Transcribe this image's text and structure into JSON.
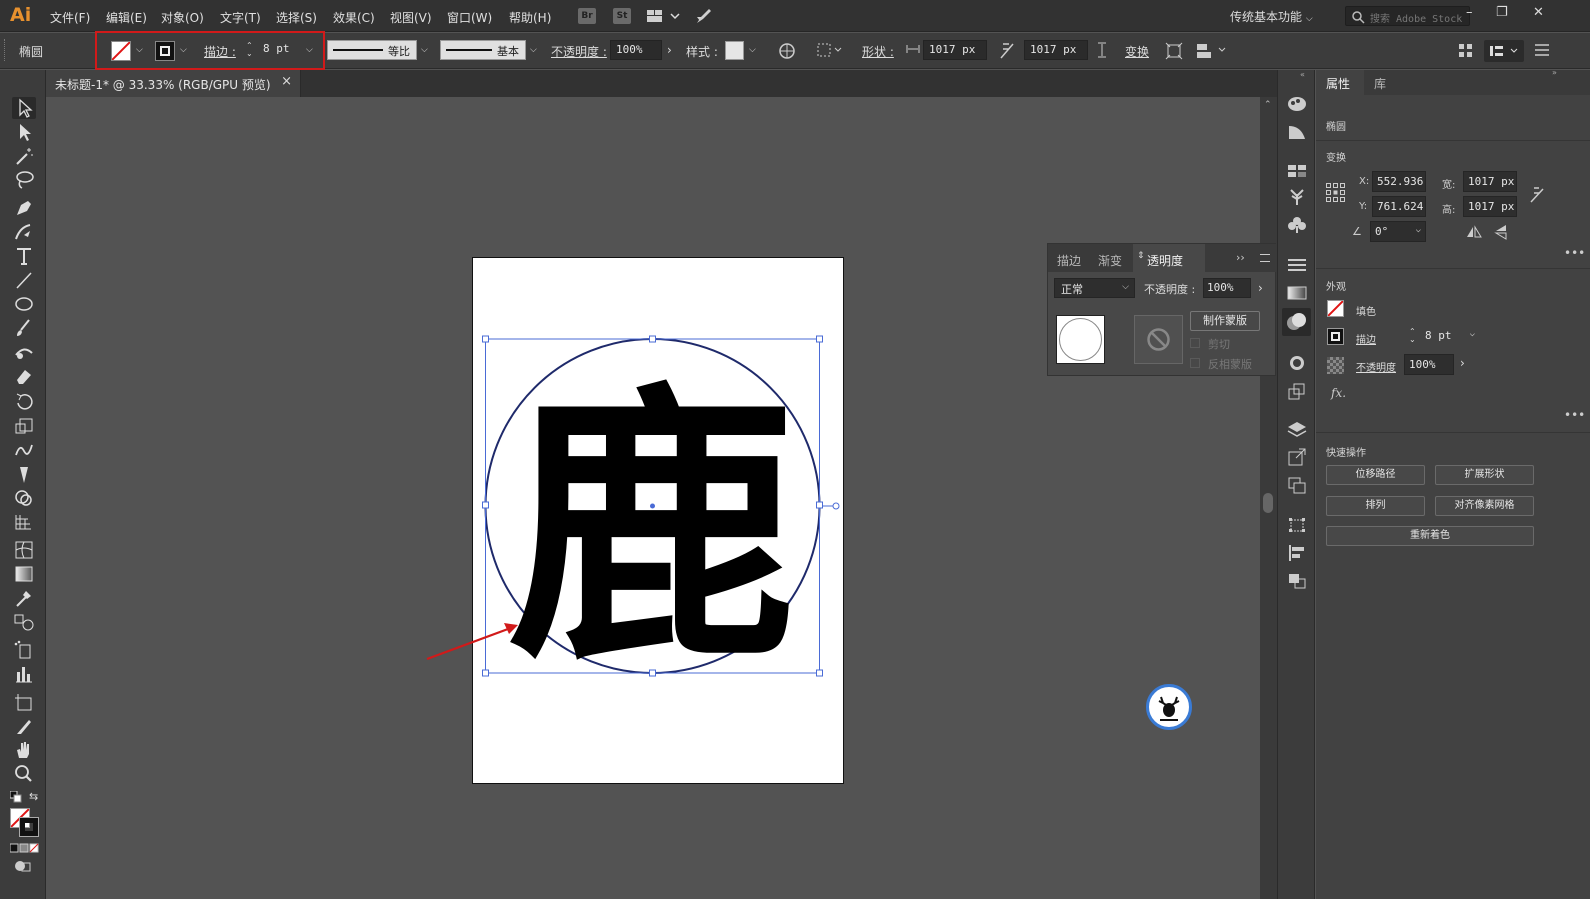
{
  "app": {
    "logo": "Ai"
  },
  "menu": [
    "文件(F)",
    "编辑(E)",
    "对象(O)",
    "文字(T)",
    "选择(S)",
    "效果(C)",
    "视图(V)",
    "窗口(W)",
    "帮助(H)"
  ],
  "menu_icons": {
    "bridge": "Br",
    "stock": "St"
  },
  "workspace": "传统基本功能",
  "search": {
    "placeholder": "搜索 Adobe Stock"
  },
  "window_controls": {
    "minimize": "–",
    "restore": "❐",
    "close": "✕"
  },
  "control_bar": {
    "object_type": "椭圆",
    "stroke_label": "描边 :",
    "stroke_value": "8 pt",
    "profile_label": "等比",
    "brush_label": "基本",
    "opacity_label": "不透明度 :",
    "opacity_value": "100%",
    "style_label": "样式 :",
    "shape_label": "形状 :",
    "width_value": "1017 px",
    "height_value": "1017 px",
    "transform_label": "变换"
  },
  "document_tab": {
    "title": "未标题-1* @ 33.33% (RGB/GPU 预览)",
    "close": "×"
  },
  "artwork": {
    "glyph": "鹿"
  },
  "transparency_panel": {
    "tabs": [
      "描边",
      "渐变",
      "透明度"
    ],
    "active_tab": "透明度",
    "blend_mode": "正常",
    "opacity_label": "不透明度 :",
    "opacity_value": "100%",
    "make_mask": "制作蒙版",
    "clip": "剪切",
    "invert_mask": "反相蒙版"
  },
  "properties": {
    "tabs": [
      "属性",
      "库"
    ],
    "object": "椭圆",
    "transform": {
      "title": "变换",
      "x_label": "X:",
      "x": "552.936",
      "y_label": "Y:",
      "y": "761.624",
      "w_label": "宽:",
      "w": "1017 px",
      "h_label": "高:",
      "h": "1017 px",
      "angle": "0°"
    },
    "appearance": {
      "title": "外观",
      "fill_label": "填色",
      "stroke_label": "描边",
      "stroke_value": "8 pt",
      "opacity_label": "不透明度",
      "opacity_value": "100%",
      "fx_label": "fx."
    },
    "quick_actions": {
      "title": "快速操作",
      "buttons": [
        "位移路径",
        "扩展形状",
        "排列",
        "对齐像素网格",
        "重新着色"
      ]
    }
  },
  "colors": {
    "accent_red": "#d11a1a",
    "selection_blue": "#4a6bd6",
    "ai_orange": "#e8912e"
  }
}
